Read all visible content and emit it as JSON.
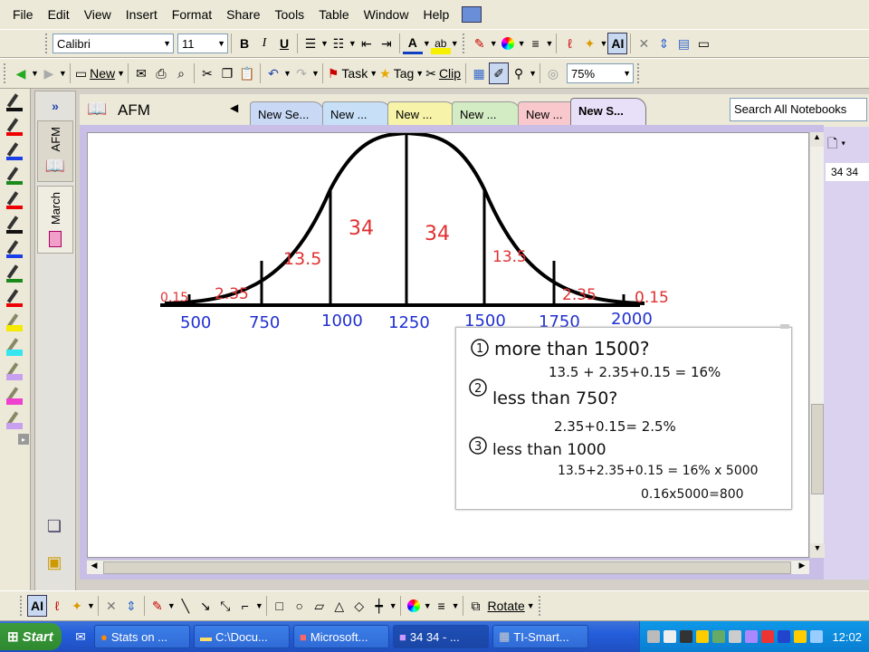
{
  "menubar": {
    "items": [
      "File",
      "Edit",
      "View",
      "Insert",
      "Format",
      "Share",
      "Tools",
      "Table",
      "Window",
      "Help"
    ]
  },
  "format_toolbar": {
    "font": "Calibri",
    "size": "11",
    "bold": "B",
    "italic": "I",
    "underline": "U",
    "font_color_glyph": "A",
    "highlight_glyph": "ab"
  },
  "standard_toolbar": {
    "new_label": "New",
    "task_label": "Task",
    "tag_label": "Tag",
    "clip_label": "Clip",
    "zoom": "75%"
  },
  "notebook": {
    "name": "AFM",
    "sections": [
      "AFM",
      "March"
    ],
    "tabs": [
      "New Se...",
      "New ...",
      "New ...",
      "New ...",
      "New ...",
      "New S..."
    ],
    "search_placeholder": "Search All Notebooks",
    "page_title": "34 34"
  },
  "colors": {
    "tab1": "#c9d9f5",
    "tab2": "#c7e0f8",
    "tab3": "#f7f3a8",
    "tab4": "#d4ecc4",
    "tab5": "#f8c8cc",
    "tab6": "#e8e0f8",
    "accent": "#c8bee6"
  },
  "curve": {
    "x_labels": [
      "500",
      "750",
      "1000",
      "1250",
      "1500",
      "1750",
      "2000"
    ],
    "percent_labels": [
      "0.15",
      "2.35",
      "13.5",
      "34",
      "34",
      "13.5",
      "2.35",
      "0.15"
    ]
  },
  "notes": {
    "q1": "more than 1500?",
    "q1_calc": "13.5 + 2.35+0.15 = 16%",
    "q2": "less than 750?",
    "q2_calc": "2.35+0.15= 2.5%",
    "q3": "less than 1000",
    "q3_calc": "13.5+2.35+0.15 = 16% x 5000",
    "q3_result": "0.16x5000=800",
    "n1": "1",
    "n2": "2",
    "n3": "3"
  },
  "drawbar": {
    "rotate_label": "Rotate"
  },
  "taskbar": {
    "start": "Start",
    "tasks": [
      "Stats on ...",
      "C:\\Docu...",
      "Microsoft...",
      "34 34 - ...",
      "TI-Smart..."
    ],
    "clock": "12:02"
  }
}
